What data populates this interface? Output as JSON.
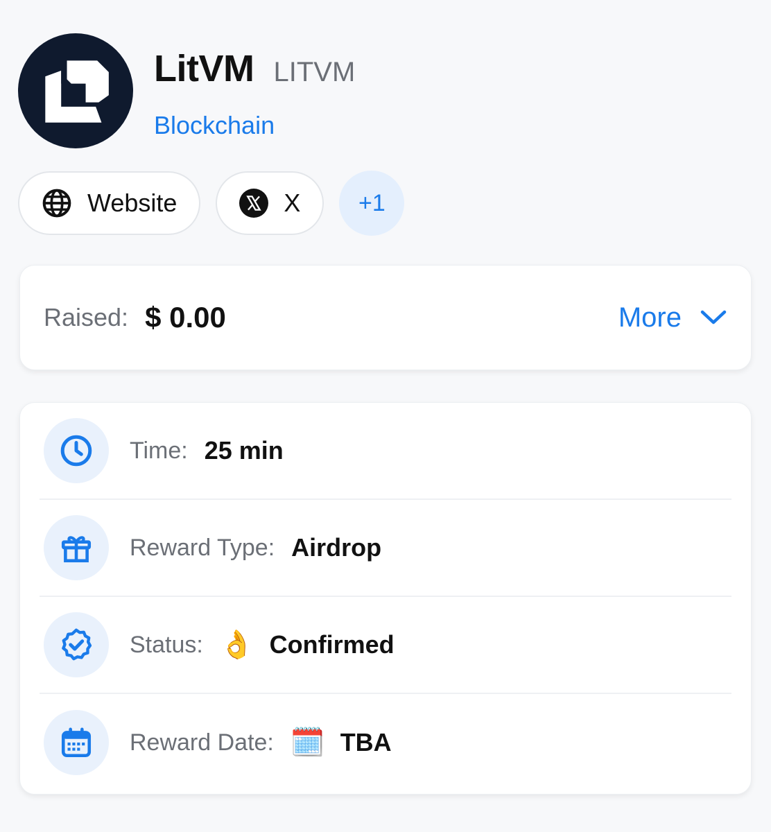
{
  "project": {
    "name": "LitVM",
    "ticker": "LITVM",
    "category": "Blockchain"
  },
  "links": {
    "website_label": "Website",
    "x_label": "X",
    "more_count": "+1"
  },
  "raised": {
    "label": "Raised:",
    "value": "$ 0.00",
    "more_label": "More"
  },
  "details": {
    "time": {
      "label": "Time:",
      "value": "25 min"
    },
    "reward_type": {
      "label": "Reward Type:",
      "value": "Airdrop"
    },
    "status": {
      "label": "Status:",
      "emoji": "👌",
      "value": "Confirmed"
    },
    "reward_date": {
      "label": "Reward Date:",
      "emoji": "🗓️",
      "value": "TBA"
    }
  },
  "colors": {
    "accent": "#1a7bea",
    "logo_bg": "#0f1a2e",
    "icon_bg": "#e9f1fc"
  }
}
